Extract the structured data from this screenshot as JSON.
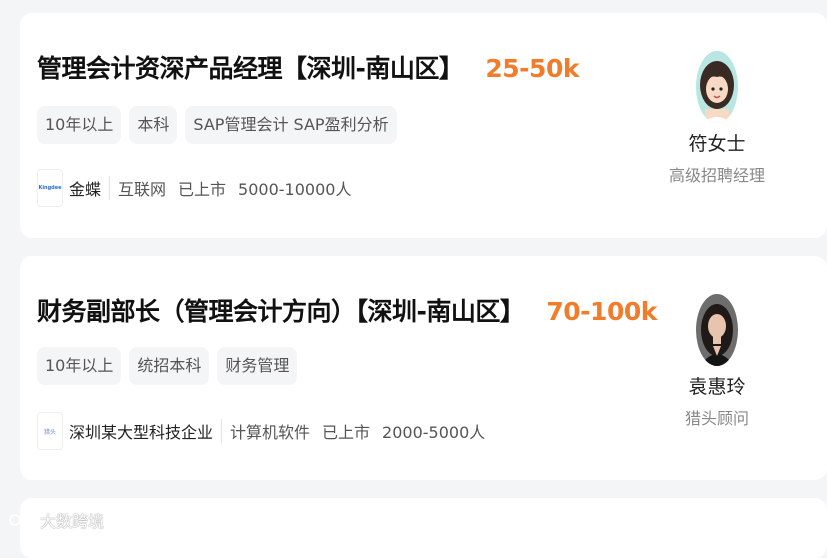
{
  "jobs": [
    {
      "title": "管理会计资深产品经理【深圳-南山区】",
      "salary": "25-50k",
      "tags": [
        "10年以上",
        "本科",
        "SAP管理会计 SAP盈利分析"
      ],
      "company": {
        "logo_text": "Kingdee",
        "name": "金蝶",
        "industry": "互联网",
        "status": "已上市",
        "size": "5000-10000人"
      },
      "recruiter": {
        "name": "符女士",
        "title": "高级招聘经理"
      }
    },
    {
      "title": "财务副部长（管理会计方向）【深圳-南山区】",
      "salary": "70-100k",
      "tags": [
        "10年以上",
        "统招本科",
        "财务管理"
      ],
      "company": {
        "logo_text": "猎头",
        "name": "深圳某大型科技企业",
        "industry": "计算机软件",
        "status": "已上市",
        "size": "2000-5000人"
      },
      "recruiter": {
        "name": "袁惠玲",
        "title": "猎头顾问"
      }
    }
  ],
  "watermark": {
    "text": "大数跨境"
  },
  "colors": {
    "salary": "#f07c2c",
    "background": "#f4f5f7",
    "card": "#ffffff"
  }
}
